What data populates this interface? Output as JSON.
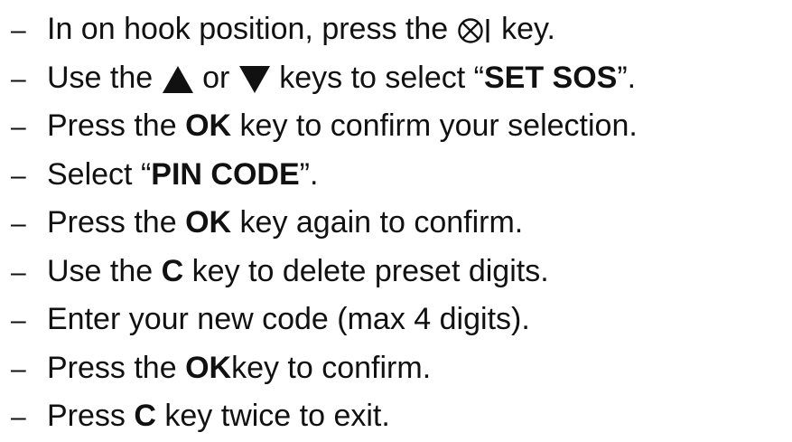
{
  "instructions": {
    "dash": "–",
    "step1": {
      "pre": "In on hook position, press the",
      "post": "key."
    },
    "step2": {
      "pre": "Use the",
      "mid": "or",
      "post": "keys to select “",
      "bold": "SET SOS",
      "end": "”."
    },
    "step3": {
      "pre": "Press the",
      "bold": "OK",
      "post": "key to confirm your selection."
    },
    "step4": {
      "pre": "Select “",
      "bold": "PIN CODE",
      "post": "”."
    },
    "step5": {
      "pre": "Press the",
      "bold": "OK",
      "post": "key again to confirm."
    },
    "step6": {
      "pre": "Use the",
      "bold": "C",
      "post": "key to delete preset digits."
    },
    "step7": {
      "text": "Enter your new code (max 4 digits)."
    },
    "step8": {
      "pre": "Press the",
      "bold": "OK",
      "post": "key to confirm."
    },
    "step9": {
      "pre": "Press",
      "bold": "C",
      "post": "key twice to exit."
    }
  },
  "icons": {
    "menu_key": "menu-key-icon",
    "up_key": "up-arrow-icon",
    "down_key": "down-arrow-icon"
  }
}
